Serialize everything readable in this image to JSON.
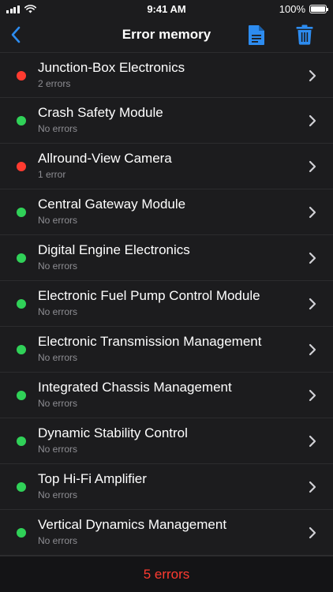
{
  "status_bar": {
    "time": "9:41 AM",
    "battery": "100%",
    "icons": [
      "signal-icon",
      "wifi-icon",
      "battery-icon"
    ]
  },
  "nav": {
    "title": "Error memory",
    "icons": [
      "back-chevron-icon",
      "document-icon",
      "trash-icon"
    ]
  },
  "colors": {
    "accent": "#2d8cf0",
    "error": "#ff3b30",
    "ok": "#30d158",
    "background": "#1c1c1e"
  },
  "modules": [
    {
      "name": "Junction-Box Electronics",
      "status": "2 errors",
      "state": "error"
    },
    {
      "name": "Crash Safety Module",
      "status": "No errors",
      "state": "ok"
    },
    {
      "name": "Allround-View Camera",
      "status": "1 error",
      "state": "error"
    },
    {
      "name": "Central Gateway Module",
      "status": "No errors",
      "state": "ok"
    },
    {
      "name": "Digital Engine Electronics",
      "status": "No errors",
      "state": "ok"
    },
    {
      "name": "Electronic Fuel Pump Control Module",
      "status": "No errors",
      "state": "ok"
    },
    {
      "name": "Electronic Transmission Management",
      "status": "No errors",
      "state": "ok"
    },
    {
      "name": "Integrated Chassis Management",
      "status": "No errors",
      "state": "ok"
    },
    {
      "name": "Dynamic Stability Control",
      "status": "No errors",
      "state": "ok"
    },
    {
      "name": "Top Hi-Fi Amplifier",
      "status": "No errors",
      "state": "ok"
    },
    {
      "name": "Vertical Dynamics Management",
      "status": "No errors",
      "state": "ok"
    }
  ],
  "footer": {
    "summary": "5 errors"
  }
}
